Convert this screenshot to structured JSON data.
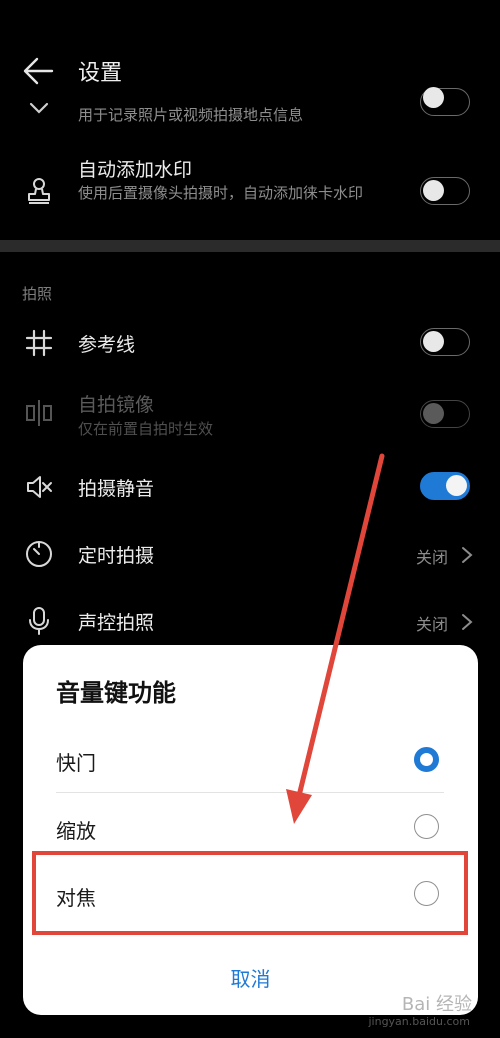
{
  "header": {
    "title": "设置"
  },
  "rows": {
    "location_sub": "用于记录照片或视频拍摄地点信息",
    "watermark": {
      "title": "自动添加水印",
      "sub": "使用后置摄像头拍摄时，自动添加徕卡水印"
    },
    "section": "拍照",
    "grid": {
      "title": "参考线"
    },
    "mirror": {
      "title": "自拍镜像",
      "sub": "仅在前置自拍时生效"
    },
    "mute": {
      "title": "拍摄静音"
    },
    "timer": {
      "title": "定时拍摄",
      "status": "关闭"
    },
    "voice": {
      "title": "声控拍照",
      "status": "关闭"
    }
  },
  "dialog": {
    "title": "音量键功能",
    "options": [
      {
        "label": "快门",
        "selected": true
      },
      {
        "label": "缩放",
        "selected": false
      },
      {
        "label": "对焦",
        "selected": false
      }
    ],
    "cancel": "取消"
  },
  "watermark": {
    "text": "Bai 经验",
    "url": "jingyan.baidu.com"
  },
  "colors": {
    "accent": "#1f7ad6",
    "annotation": "#e0463a"
  }
}
